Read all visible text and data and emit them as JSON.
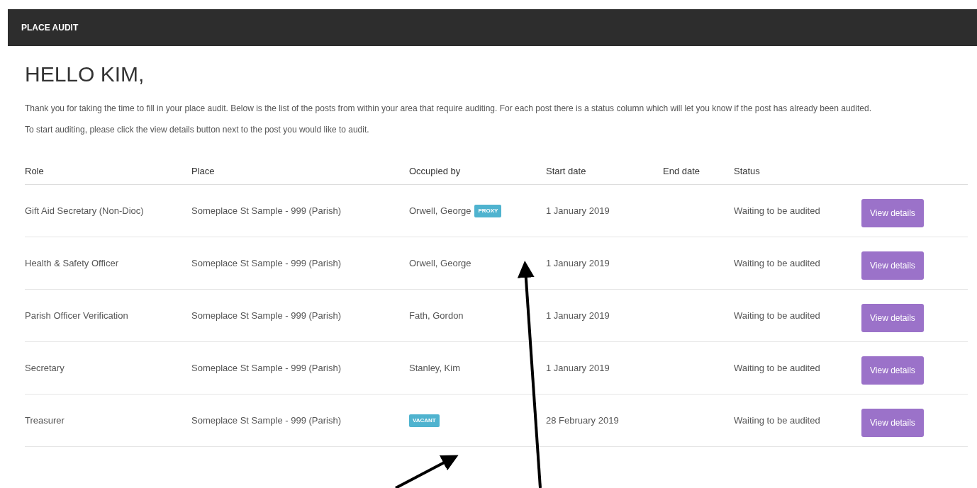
{
  "header": {
    "title": "PLACE AUDIT"
  },
  "greeting": "HELLO KIM,",
  "intro": [
    "Thank you for taking the time to fill in your place audit. Below is the list of the posts from within your area that require auditing. For each post there is a status column which will let you know if the post has already been audited.",
    "To start auditing, please click the view details button next to the post you would like to audit."
  ],
  "table": {
    "columns": [
      "Role",
      "Place",
      "Occupied by",
      "Start date",
      "End date",
      "Status"
    ],
    "rows": [
      {
        "role": "Gift Aid Secretary (Non-Dioc)",
        "place": "Someplace St Sample - 999 (Parish)",
        "occupied_by": "Orwell, George",
        "badge": "PROXY",
        "start_date": "1 January 2019",
        "status": "Waiting to be audited",
        "button": "View details"
      },
      {
        "role": "Health & Safety Officer",
        "place": "Someplace St Sample - 999 (Parish)",
        "occupied_by": "Orwell, George",
        "start_date": "1 January 2019",
        "status": "Waiting to be audited",
        "button": "View details"
      },
      {
        "role": "Parish Officer Verification",
        "place": "Someplace St Sample - 999 (Parish)",
        "occupied_by": "Fath, Gordon",
        "start_date": "1 January 2019",
        "status": "Waiting to be audited",
        "button": "View details"
      },
      {
        "role": "Secretary",
        "place": "Someplace St Sample - 999 (Parish)",
        "occupied_by": "Stanley, Kim",
        "start_date": "1 January 2019",
        "status": "Waiting to be audited",
        "button": "View details"
      },
      {
        "role": "Treasurer",
        "place": "Someplace St Sample - 999 (Parish)",
        "badge": "VACANT",
        "start_date": "28 February 2019",
        "status": "Waiting to be audited",
        "button": "View details"
      }
    ]
  }
}
